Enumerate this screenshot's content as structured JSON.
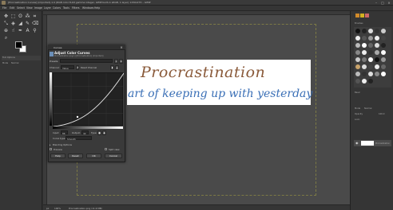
{
  "window": {
    "title": "[Procrastination Curves] (imported)-1.0 (RGB color 8-bit gamma integer, GIMP built-in sRGB, 1 layer) 1150x270 – GIMP"
  },
  "menubar": {
    "items": [
      "File",
      "Edit",
      "Select",
      "View",
      "Image",
      "Layer",
      "Colors",
      "Tools",
      "Filters",
      "Windows",
      "Help"
    ]
  },
  "canvas": {
    "title_text": "Procrastination",
    "subtitle_text": "art of keeping up with yesterday",
    "title_color": "#8a5a3a",
    "subtitle_color": "#3a6fb6"
  },
  "left_panel": {
    "tool_options_label": "Tool Options",
    "mode_label": "Mode",
    "mode_value": "Normal"
  },
  "curves_dialog": {
    "window_title": "Curves",
    "heading": "Adjust Color Curves",
    "subheading": "Procrastination.png-1 ([Procrastination] (imported))",
    "presets_label": "Presets:",
    "channel_label": "Channel:",
    "channel_value": "Value",
    "reset_channel_label": "Reset Channel",
    "input_label": "Input:",
    "input_value": "86",
    "output_label": "Output:",
    "output_value": "44",
    "type_label": "Type:",
    "curve_type_label": "Curve type:",
    "curve_type_value": "Smooth",
    "blending_label": "Blending Options",
    "preview_label": "Preview",
    "split_view_label": "Split view",
    "buttons": {
      "help": "Help",
      "reset": "Reset",
      "ok": "OK",
      "cancel": "Cancel"
    }
  },
  "statusbar": {
    "unit": "px",
    "zoom": "100%",
    "message": "Procrastination.png (11.9 MB)"
  },
  "right_dock": {
    "brushes_label": "Brushes",
    "basic_label": "Basic",
    "mode_label": "Mode",
    "mode_value": "Normal",
    "opacity_label": "Opacity",
    "opacity_value": "100.0",
    "lock_label": "Lock:",
    "layer_name": "Procrastination"
  }
}
